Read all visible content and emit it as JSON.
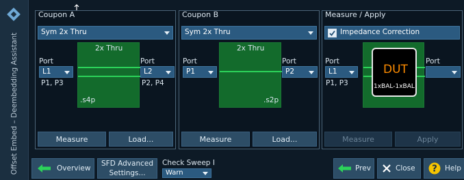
{
  "sidebar": {
    "title": "Offset Embed – Deembedding Assistant"
  },
  "coupon_a": {
    "title": "Coupon A",
    "dropdown": "Sym 2x Thru",
    "box_label": "2x Thru",
    "port_left_label": "Port",
    "port_left_value": "L1",
    "port_left_sub": "P1, P3",
    "port_right_label": "Port",
    "port_right_value": "L2",
    "port_right_sub": "P2, P4",
    "file_ext": ".s4p",
    "measure_label": "Measure",
    "load_label": "Load..."
  },
  "coupon_b": {
    "title": "Coupon B",
    "dropdown": "Sym 2x Thru",
    "box_label": "2x Thru",
    "port_left_label": "Port",
    "port_left_value": "P1",
    "port_right_label": "Port",
    "port_right_value": "P2",
    "file_ext": ".s2p",
    "measure_label": "Measure",
    "load_label": "Load..."
  },
  "measure_apply": {
    "title": "Measure / Apply",
    "checkbox_label": "Impedance Correction",
    "checkbox_checked": true,
    "port_left_label": "Port",
    "port_left_value": "L1",
    "port_left_sub": "P1, P3",
    "port_right_label": "Port",
    "port_right_value": "",
    "dut_label": "DUT",
    "dut_sub": "1xBAL-1xBAL",
    "measure_label": "Measure",
    "apply_label": "Apply"
  },
  "bottom": {
    "overview_label": "Overview",
    "sfd_label_1": "SFD Advanced",
    "sfd_label_2": "Settings...",
    "check_sweep_label": "Check Sweep Pc",
    "check_sweep_value": "Warn",
    "prev_label": "Prev",
    "close_label": "Close",
    "help_label": "Help"
  },
  "colors": {
    "accent_green": "#2cd35a",
    "box_green": "#136b2c",
    "dropdown_blue": "#2b5a80",
    "button_blue": "#2d4d66",
    "help_yellow": "#f5c400",
    "dut_orange": "#ff8c00"
  }
}
